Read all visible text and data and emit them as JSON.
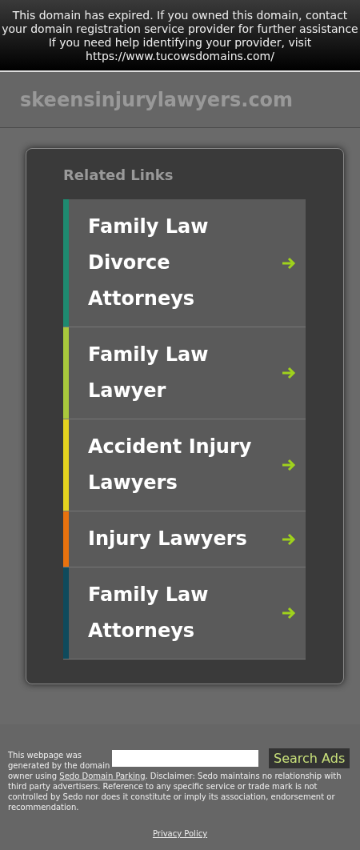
{
  "banner": {
    "lines": [
      "This domain has expired. If you owned this domain, contact",
      "your domain registration service provider for further assistance",
      "If you need help identifying your provider, visit",
      "https://www.tucowsdomains.com/"
    ]
  },
  "header": {
    "domain": "skeensinjurylawyers.com"
  },
  "related": {
    "title": "Related Links",
    "links": [
      {
        "label": "Family Law Divorce Attorneys",
        "color": "#1e8a70"
      },
      {
        "label": "Family Law Lawyer",
        "color": "#a9c93c"
      },
      {
        "label": "Accident Injury Lawyers",
        "color": "#e5d31f"
      },
      {
        "label": "Injury Lawyers",
        "color": "#e8720e"
      },
      {
        "label": "Family Law Attorneys",
        "color": "#0f4a5c"
      }
    ]
  },
  "footer": {
    "intro": "This webpage was generated by the domain",
    "owner": "owner using",
    "link": "Sedo Domain Parking",
    "rest": ". Disclaimer: Sedo maintains no relationship with third party advertisers. Reference to any specific service or trade mark is not controlled by Sedo nor does it constitute or imply its association, endorsement or recommendation.",
    "search_button": "Search Ads",
    "privacy": "Privacy Policy"
  }
}
